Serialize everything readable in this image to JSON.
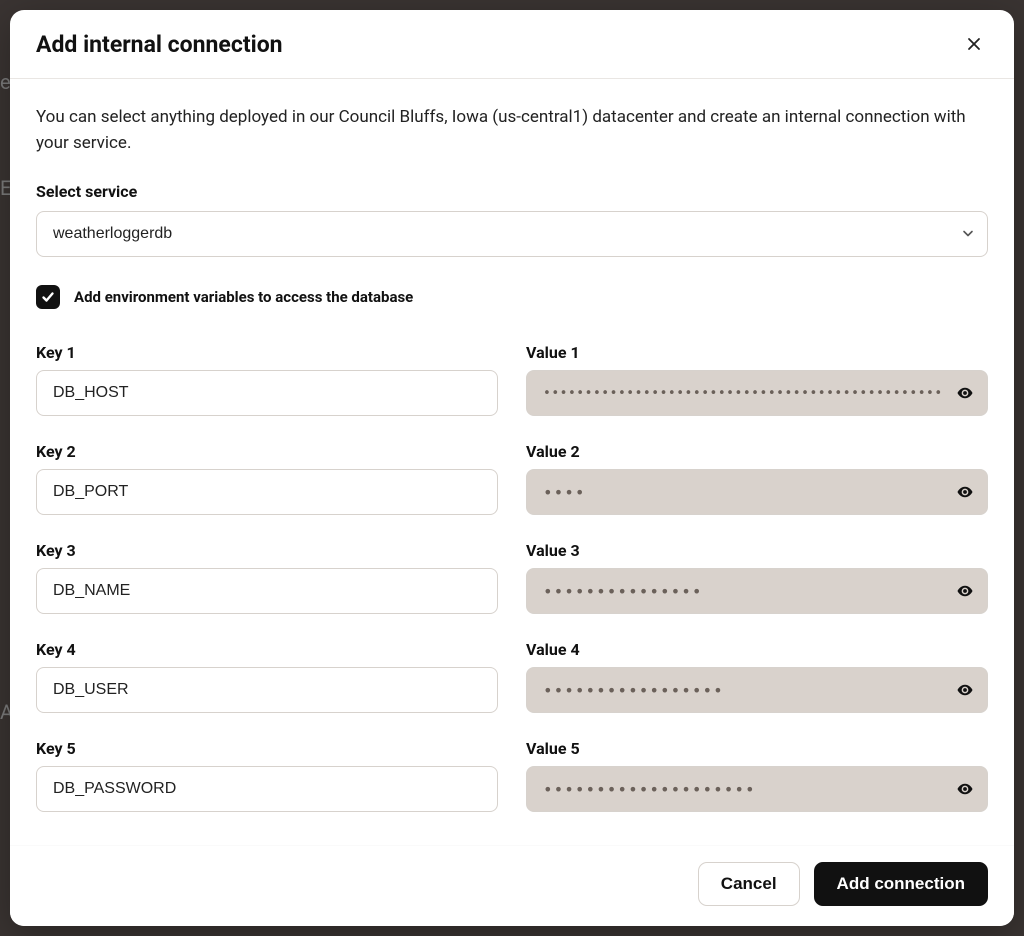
{
  "modal": {
    "title": "Add internal connection",
    "description": "You can select anything deployed in our Council Bluffs, Iowa (us-central1) datacenter and create an internal connection with your service.",
    "select_label": "Select service",
    "select_value": "weatherloggerdb",
    "checkbox_label": "Add environment variables to access the database",
    "checkbox_checked": true,
    "env_vars": [
      {
        "key_label": "Key 1",
        "value_label": "Value 1",
        "key": "DB_HOST",
        "masked": "••••••••••••••••••••••••••••••••••••••••••••••••••••…",
        "long": true
      },
      {
        "key_label": "Key 2",
        "value_label": "Value 2",
        "key": "DB_PORT",
        "masked": "••••"
      },
      {
        "key_label": "Key 3",
        "value_label": "Value 3",
        "key": "DB_NAME",
        "masked": "•••••••••••••••"
      },
      {
        "key_label": "Key 4",
        "value_label": "Value 4",
        "key": "DB_USER",
        "masked": "•••••••••••••••••"
      },
      {
        "key_label": "Key 5",
        "value_label": "Value 5",
        "key": "DB_PASSWORD",
        "masked": "••••••••••••••••••••"
      }
    ],
    "footer": {
      "cancel": "Cancel",
      "confirm": "Add connection"
    }
  }
}
